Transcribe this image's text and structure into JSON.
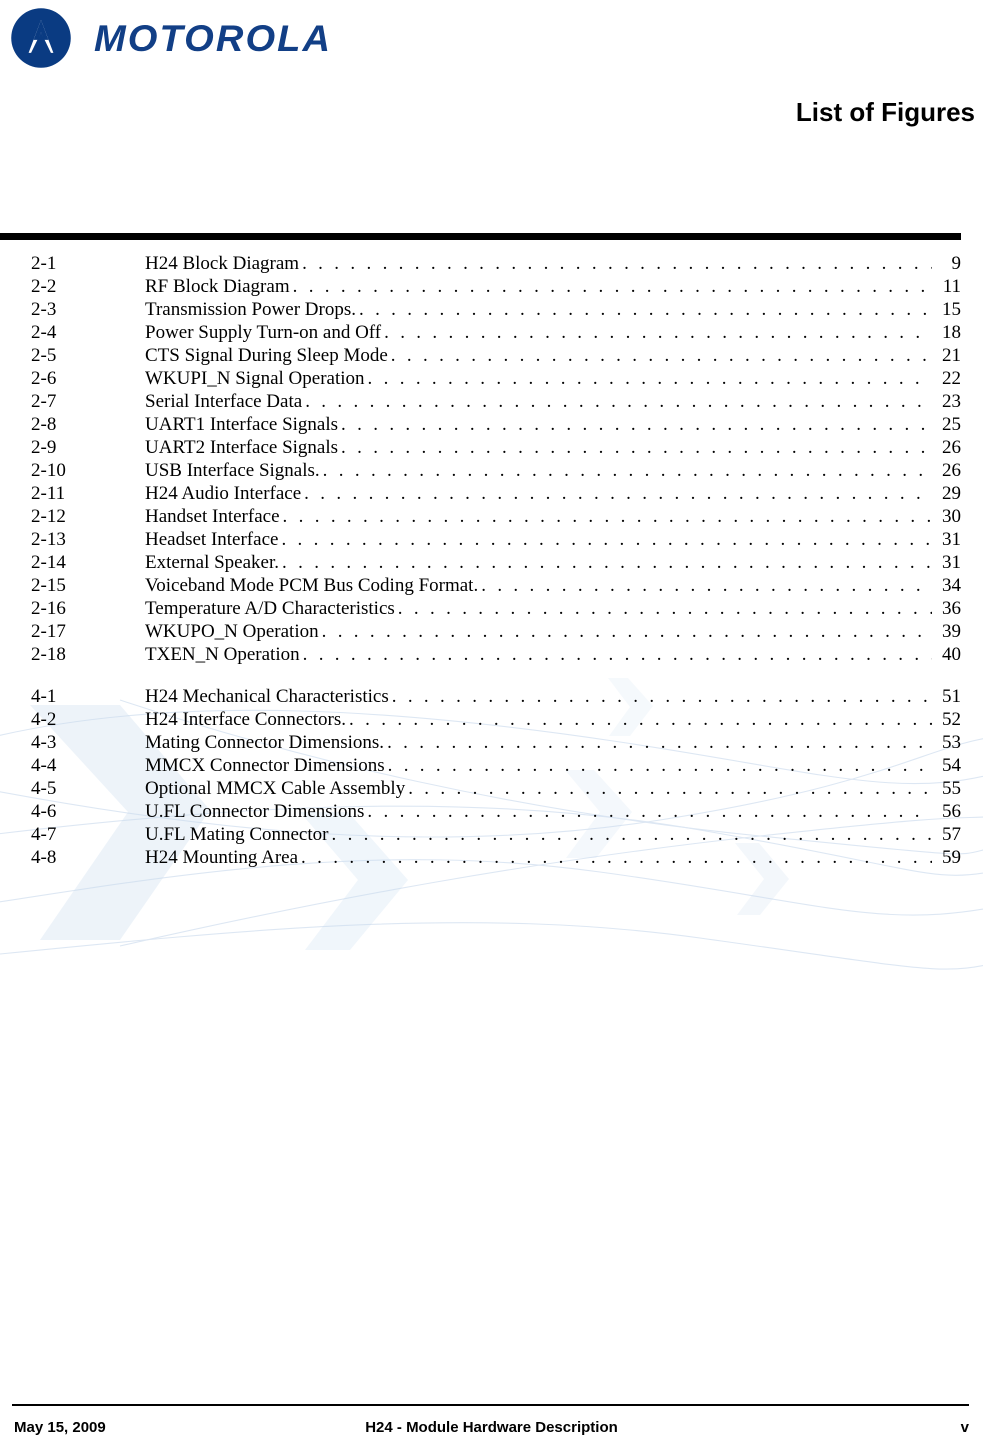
{
  "brand": {
    "logo_icon": "motorola-batwing-icon",
    "wordmark": "MOTOROLA",
    "logo_color": "#0A3B82",
    "wordmark_color": "#123F86"
  },
  "header": {
    "title": "List of Figures"
  },
  "figure_list": {
    "groups": [
      {
        "chapter": "2",
        "rows": [
          {
            "number": "2-1",
            "title": "H24 Block Diagram",
            "page": "9"
          },
          {
            "number": "2-2",
            "title": "RF Block Diagram",
            "page": "11"
          },
          {
            "number": "2-3",
            "title": "Transmission Power Drops.",
            "page": "15"
          },
          {
            "number": "2-4",
            "title": "Power Supply Turn-on and Off",
            "page": "18"
          },
          {
            "number": "2-5",
            "title": "CTS Signal During Sleep Mode",
            "page": "21"
          },
          {
            "number": "2-6",
            "title": "WKUPI_N Signal Operation",
            "page": "22"
          },
          {
            "number": "2-7",
            "title": "Serial Interface Data",
            "page": "23"
          },
          {
            "number": "2-8",
            "title": "UART1 Interface Signals",
            "page": "25"
          },
          {
            "number": "2-9",
            "title": "UART2 Interface Signals",
            "page": "26"
          },
          {
            "number": "2-10",
            "title": "USB Interface Signals.",
            "page": "26"
          },
          {
            "number": "2-11",
            "title": "H24 Audio Interface",
            "page": "29"
          },
          {
            "number": "2-12",
            "title": "Handset Interface",
            "page": "30"
          },
          {
            "number": "2-13",
            "title": "Headset Interface",
            "page": "31"
          },
          {
            "number": "2-14",
            "title": "External Speaker.",
            "page": "31"
          },
          {
            "number": "2-15",
            "title": "Voiceband Mode PCM Bus Coding Format.",
            "page": "34"
          },
          {
            "number": "2-16",
            "title": "Temperature A/D Characteristics",
            "page": "36"
          },
          {
            "number": "2-17",
            "title": "WKUPO_N Operation",
            "page": "39"
          },
          {
            "number": "2-18",
            "title": "TXEN_N Operation",
            "page": "40"
          }
        ]
      },
      {
        "chapter": "4",
        "rows": [
          {
            "number": "4-1",
            "title": "H24 Mechanical Characteristics",
            "page": "51"
          },
          {
            "number": "4-2",
            "title": "H24 Interface Connectors.",
            "page": "52"
          },
          {
            "number": "4-3",
            "title": "Mating Connector Dimensions.",
            "page": "53"
          },
          {
            "number": "4-4",
            "title": "MMCX Connector Dimensions",
            "page": "54"
          },
          {
            "number": "4-5",
            "title": "Optional MMCX Cable Assembly",
            "page": "55"
          },
          {
            "number": "4-6",
            "title": "U.FL Connector Dimensions",
            "page": "56"
          },
          {
            "number": "4-7",
            "title": "U.FL Mating Connector",
            "page": "57"
          },
          {
            "number": "4-8",
            "title": "H24 Mounting Area",
            "page": "59"
          }
        ]
      }
    ],
    "leader_char": "."
  },
  "footer": {
    "date": "May 15, 2009",
    "document_title": "H24 - Module Hardware Description",
    "page_number": "v"
  }
}
